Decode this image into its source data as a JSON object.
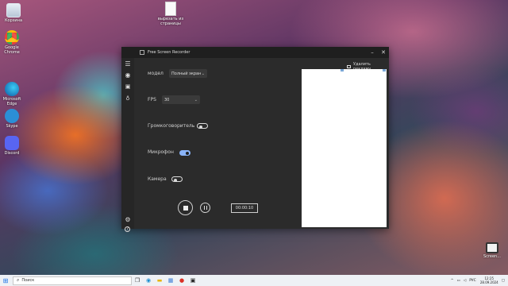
{
  "desktop": {
    "icons": [
      {
        "label": "Корзина",
        "icon": "recycle-bin-icon"
      },
      {
        "label": "Google Chrome",
        "icon": "chrome-icon"
      },
      {
        "label": "Microsoft Edge",
        "icon": "edge-icon"
      },
      {
        "label": "Skype",
        "icon": "skype-icon"
      },
      {
        "label": "Discord",
        "icon": "discord-icon"
      },
      {
        "label": "вырезать из страницы",
        "icon": "document-icon"
      },
      {
        "label": "Screen...",
        "icon": "recorder-desktop-icon"
      }
    ]
  },
  "app": {
    "title": "Free Screen Recorder",
    "remove_ad": "Удалить рекламу",
    "mode_label": "модел",
    "mode_value": "Полный экран",
    "fps_label": "FPS",
    "fps_value": "30",
    "speaker_label": "Громкоговоритель",
    "speaker_on": false,
    "mic_label": "Микрофон",
    "mic_on": true,
    "camera_label": "Камера",
    "camera_on": false,
    "timer": "00:00:10",
    "accent": "#8ab4f8"
  },
  "taskbar": {
    "search_placeholder": "Поиск",
    "language": "РУС",
    "time": "12:25",
    "date": "28.09.2024"
  }
}
